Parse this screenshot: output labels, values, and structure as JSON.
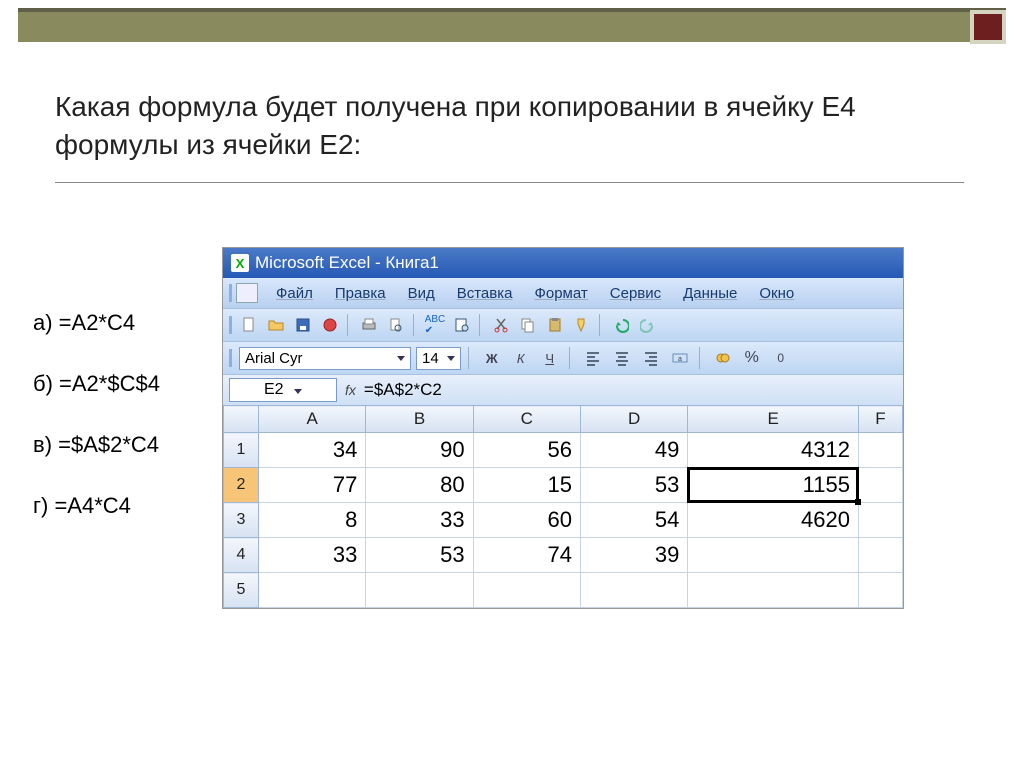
{
  "question": "Какая формула будет получена при копировании в ячейку E4 формулы из ячейки E2:",
  "answers": {
    "a": "а) =A2*C4",
    "b": "б) =A2*$C$4",
    "c": "в) =$A$2*C4",
    "d": "г) =A4*C4"
  },
  "excel": {
    "title": "Microsoft Excel - Книга1",
    "menu": [
      "Файл",
      "Правка",
      "Вид",
      "Вставка",
      "Формат",
      "Сервис",
      "Данные",
      "Окно"
    ],
    "font": "Arial Cyr",
    "fontsize": "14",
    "namebox": "E2",
    "formula": "=$A$2*C2",
    "cols": [
      "A",
      "B",
      "C",
      "D",
      "E",
      "F"
    ],
    "rows": [
      {
        "n": "1",
        "v": [
          "34",
          "90",
          "56",
          "49",
          "4312",
          ""
        ]
      },
      {
        "n": "2",
        "v": [
          "77",
          "80",
          "15",
          "53",
          "1155",
          ""
        ]
      },
      {
        "n": "3",
        "v": [
          "8",
          "33",
          "60",
          "54",
          "4620",
          ""
        ]
      },
      {
        "n": "4",
        "v": [
          "33",
          "53",
          "74",
          "39",
          "",
          ""
        ]
      },
      {
        "n": "5",
        "v": [
          "",
          "",
          "",
          "",
          "",
          ""
        ]
      }
    ]
  }
}
